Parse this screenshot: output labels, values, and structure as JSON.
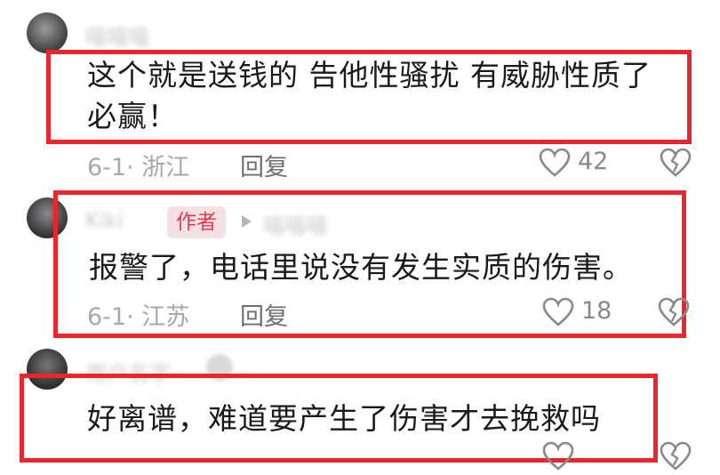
{
  "comments": [
    {
      "username": "喵喵喵",
      "text_line1": "这个就是送钱的 告他性骚扰 有威胁性质了",
      "text_line2": "必赢！",
      "meta": "6-1· 浙江",
      "reply_label": "回复",
      "like_count": "42"
    },
    {
      "username": "Kiki",
      "author_badge": "作者",
      "reply_to": "喵喵喵",
      "text_line1": "报警了，电话里说没有发生实质的伤害。",
      "meta": "6-1· 江苏",
      "reply_label": "回复",
      "like_count": "18"
    },
    {
      "username": "用户名字",
      "text_line1": "好离谱，难道要产生了伤害才去挽救吗"
    }
  ],
  "icons": {
    "like": "heart-outline-icon",
    "dislike": "broken-heart-icon",
    "reply_arrow": "triangle-right-icon"
  },
  "colors": {
    "highlight_box": "#e8262c",
    "author_badge_text": "#e83a52",
    "author_badge_bg": "#f4e1e3"
  }
}
